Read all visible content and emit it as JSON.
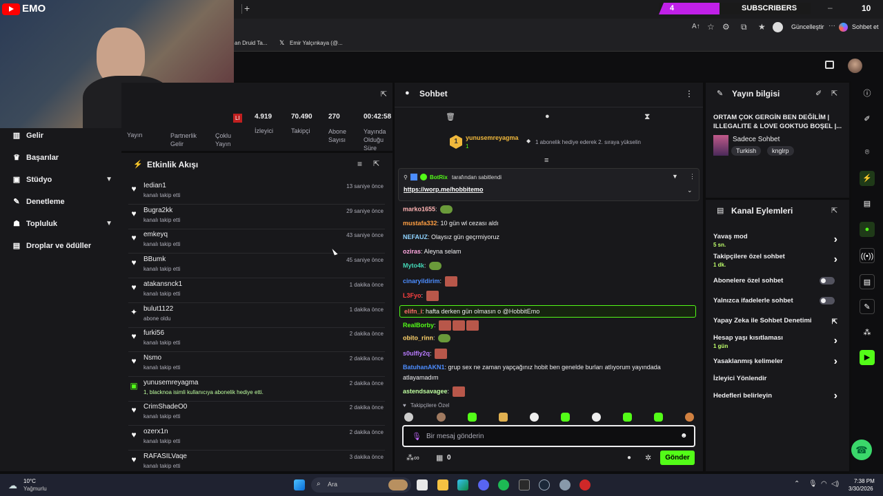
{
  "overlay": {
    "channel": "EMO",
    "sub_count": "4",
    "sub_label": "SUBSCRIBERS",
    "sub_goal": "10"
  },
  "browser": {
    "update_label": "Güncelleştir",
    "chat_label": "Sohbet et",
    "bookmarks": [
      "an Druid Ta...",
      "Emir Yalçınkaya (@..."
    ]
  },
  "leftnav": {
    "items": [
      {
        "label": "Gelir",
        "icon": "chart-icon"
      },
      {
        "label": "Başarılar",
        "icon": "trophy-icon"
      },
      {
        "label": "Stüdyo",
        "icon": "studio-icon"
      },
      {
        "label": "Denetleme",
        "icon": "wrench-icon"
      },
      {
        "label": "Topluluk",
        "icon": "community-icon"
      },
      {
        "label": "Droplar ve ödüller",
        "icon": "drops-icon"
      }
    ]
  },
  "stats": {
    "live_badge": "LI",
    "left_labels": [
      "Yayın",
      "Partnerlik Gelir",
      "Çoklu Yayın"
    ],
    "values": [
      {
        "value": "4.919",
        "label": "İzleyici"
      },
      {
        "value": "70.490",
        "label": "Takipçi"
      },
      {
        "value": "270",
        "label": "Abone Sayısı"
      },
      {
        "value": "00:42:58",
        "label": "Yayında Olduğu Süre"
      }
    ]
  },
  "feed": {
    "title": "Etkinlik Akışı",
    "rows": [
      {
        "name": "Iedian1",
        "sub": "kanalı takip etti",
        "time": "13 saniye önce",
        "icon": "heart-icon"
      },
      {
        "name": "Bugra2kk",
        "sub": "kanalı takip etti",
        "time": "29 saniye önce",
        "icon": "heart-icon"
      },
      {
        "name": "emkeyq",
        "sub": "kanalı takip etti",
        "time": "43 saniye önce",
        "icon": "heart-icon"
      },
      {
        "name": "BBumk",
        "sub": "kanalı takip etti",
        "time": "45 saniye önce",
        "icon": "heart-icon"
      },
      {
        "name": "atakansnck1",
        "sub": "kanalı takip etti",
        "time": "1 dakika önce",
        "icon": "heart-icon"
      },
      {
        "name": "bulut1122",
        "sub": "abone oldu",
        "time": "1 dakika önce",
        "icon": "star-icon"
      },
      {
        "name": "furki56",
        "sub": "kanalı takip etti",
        "time": "2 dakika önce",
        "icon": "heart-icon"
      },
      {
        "name": "Nsmo",
        "sub": "kanalı takip etti",
        "time": "2 dakika önce",
        "icon": "heart-icon"
      },
      {
        "name": "yunusemreyagma",
        "sub": "1, blacknoa isimli kullanıcıya abonelik hediye etti.",
        "time": "2 dakika önce",
        "icon": "gift-icon"
      },
      {
        "name": "CrimShadeO0",
        "sub": "kanalı takip etti",
        "time": "2 dakika önce",
        "icon": "heart-icon"
      },
      {
        "name": "ozerx1n",
        "sub": "kanalı takip etti",
        "time": "2 dakika önce",
        "icon": "heart-icon"
      },
      {
        "name": "RAFASILVaqe",
        "sub": "kanalı takip etti",
        "time": "3 dakika önce",
        "icon": "heart-icon"
      }
    ]
  },
  "chat": {
    "title": "Sohbet",
    "gifter": {
      "name": "yunusemreyagma",
      "count": "1",
      "rank": "1",
      "msg": "1 abonelik hediye ederek 2. sıraya yükselin"
    },
    "pinned": {
      "by": "BotRix",
      "by_suffix": "tarafından sabitlendi",
      "link": "https://worp.me/hobbitemo"
    },
    "messages": [
      {
        "user": "marko1655",
        "color": "#ffb3b3",
        "text": "",
        "emotes": "frog"
      },
      {
        "user": "mustafa332",
        "color": "#ff9f43",
        "text": "10 gün wl cezası aldı",
        "emotes": ""
      },
      {
        "user": "NEFAUZ",
        "color": "#8fd3ff",
        "text": "Olaysız gün geçrmiyoruz",
        "emotes": ""
      },
      {
        "user": "oziras",
        "color": "#ffa8e0",
        "text": "Aleyna selam",
        "emotes": ""
      },
      {
        "user": "Myto4k",
        "color": "#44d7b6",
        "text": "",
        "emotes": "frog"
      },
      {
        "user": "cinaryildirim",
        "color": "#4c8dff",
        "text": "",
        "emotes": "e1"
      },
      {
        "user": "L3Fyo",
        "color": "#ff4040",
        "text": "",
        "emotes": "e1"
      },
      {
        "user": "elifn_i",
        "color": "#ff6b6b",
        "text": "hafta derken gün olmasın o @HobbitEmo",
        "emotes": "",
        "highlight": true
      },
      {
        "user": "RealBorby",
        "color": "#53fc18",
        "text": "",
        "emotes": "e3"
      },
      {
        "user": "obito_rinn",
        "color": "#ffd36b",
        "text": "",
        "emotes": "frog"
      },
      {
        "user": "s0ulfly2q",
        "color": "#b97bff",
        "text": "",
        "emotes": "e1"
      },
      {
        "user": "BatuhanAKN1",
        "color": "#4c8dff",
        "text": "grup sex ne zaman yapçağınız hobit ben genelde burları atlıyorum yayındada",
        "text2": "atlayamadım",
        "emotes": ""
      },
      {
        "user": "astendsavagee",
        "color": "#bfffa0",
        "text": "",
        "emotes": "e1"
      }
    ],
    "followers_label": "Takipçilere Özel",
    "input_placeholder": "Bir mesaj gönderin",
    "send_label": "Gönder",
    "counter": "0"
  },
  "info": {
    "title": "Yayın bilgisi",
    "stream_title": "ORTAM ÇOK GERGİN BEN DEĞİLİM | ILLEGALITE & LOVE GOKTUG BOŞEL |...",
    "category": "Sadece Sohbet",
    "tags": [
      "Turkish",
      "knglrp"
    ]
  },
  "actions": {
    "title": "Kanal Eylemleri",
    "items": [
      {
        "label": "Yavaş mod",
        "sub": "5 sn.",
        "type": "arrow"
      },
      {
        "label": "Takipçilere özel sohbet",
        "sub": "1 dk.",
        "type": "arrow"
      },
      {
        "label": "Abonelere özel sohbet",
        "sub": "",
        "type": "toggle"
      },
      {
        "label": "Yalnızca ifadelerle sohbet",
        "sub": "",
        "type": "toggle"
      },
      {
        "label": "Yapay Zeka ile Sohbet Denetimi",
        "sub": "",
        "type": "ext"
      },
      {
        "label": "Hesap yaşı kısıtlaması",
        "sub": "1 gün",
        "type": "arrow"
      },
      {
        "label": "Yasaklanmış kelimeler",
        "sub": "",
        "type": "arrow"
      },
      {
        "label": "İzleyici Yönlendir",
        "sub": "",
        "type": "none"
      },
      {
        "label": "Hedefleri belirleyin",
        "sub": "",
        "type": "arrow"
      }
    ]
  },
  "taskbar": {
    "temp": "10°C",
    "weather": "Yağmurlu",
    "search": "Ara",
    "time": "7:38 PM",
    "date": "3/30/2026"
  },
  "colors": {
    "accent": "#53fc18",
    "subs_bar": "#c020e8",
    "panel": "#18181b"
  }
}
